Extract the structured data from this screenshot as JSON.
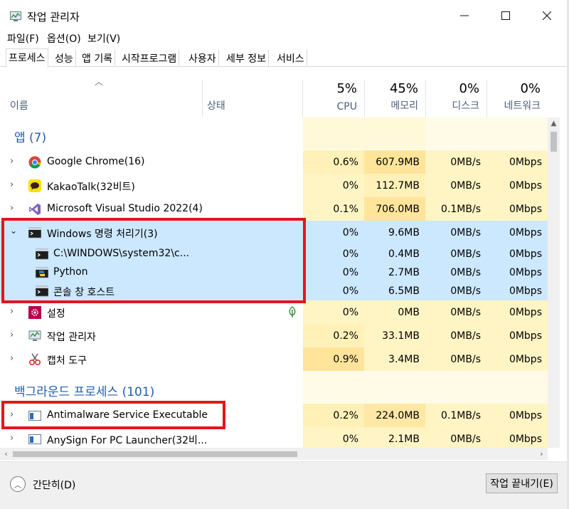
{
  "window": {
    "title": "작업 관리자",
    "buttons": {
      "minimize": "—",
      "maximize": "☐",
      "close": "✕"
    }
  },
  "menu": [
    "파일(F)",
    "옵션(O)",
    "보기(V)"
  ],
  "tabs": [
    "프로세스",
    "성능",
    "앱 기록",
    "시작프로그램",
    "사용자",
    "세부 정보",
    "서비스"
  ],
  "columns": {
    "name": "이름",
    "status": "상태",
    "cpu": {
      "percent": "5%",
      "label": "CPU"
    },
    "memory": {
      "percent": "45%",
      "label": "메모리"
    },
    "disk": {
      "percent": "0%",
      "label": "디스크"
    },
    "network": {
      "percent": "0%",
      "label": "네트워크"
    }
  },
  "groups": {
    "apps": "앱 (7)",
    "background": "백그라운드 프로세스 (101)"
  },
  "processes": [
    {
      "name": "Google Chrome(16)",
      "cpu": "0.6%",
      "mem": "607.9MB",
      "disk": "0MB/s",
      "net": "0Mbps",
      "icon": "chrome-icon"
    },
    {
      "name": "KakaoTalk(32비트)",
      "cpu": "0%",
      "mem": "112.7MB",
      "disk": "0MB/s",
      "net": "0Mbps",
      "icon": "kakaotalk-icon"
    },
    {
      "name": "Microsoft Visual Studio 2022(4)",
      "cpu": "0.1%",
      "mem": "706.0MB",
      "disk": "0.1MB/s",
      "net": "0Mbps",
      "icon": "visual-studio-icon"
    },
    {
      "name": "Windows 명령 처리기(3)",
      "cpu": "0%",
      "mem": "9.6MB",
      "disk": "0MB/s",
      "net": "0Mbps",
      "icon": "cmd-icon"
    },
    {
      "name": "C:\\WINDOWS\\system32\\c...",
      "cpu": "0%",
      "mem": "0.4MB",
      "disk": "0MB/s",
      "net": "0Mbps",
      "icon": "cmd-icon"
    },
    {
      "name": "Python",
      "cpu": "0%",
      "mem": "2.7MB",
      "disk": "0MB/s",
      "net": "0Mbps",
      "icon": "python-icon"
    },
    {
      "name": "콘솔 창 호스트",
      "cpu": "0%",
      "mem": "6.5MB",
      "disk": "0MB/s",
      "net": "0Mbps",
      "icon": "console-host-icon"
    },
    {
      "name": "설정",
      "cpu": "0%",
      "mem": "0MB",
      "disk": "0MB/s",
      "net": "0Mbps",
      "icon": "settings-icon"
    },
    {
      "name": "작업 관리자",
      "cpu": "0.2%",
      "mem": "33.1MB",
      "disk": "0MB/s",
      "net": "0Mbps",
      "icon": "task-manager-icon"
    },
    {
      "name": "캡처 도구",
      "cpu": "0.9%",
      "mem": "3.4MB",
      "disk": "0MB/s",
      "net": "0Mbps",
      "icon": "snipping-tool-icon"
    },
    {
      "name": "Antimalware Service Executable",
      "cpu": "0.2%",
      "mem": "224.0MB",
      "disk": "0.1MB/s",
      "net": "0Mbps",
      "icon": "service-icon"
    },
    {
      "name": "AnySign For PC Launcher(32비...",
      "cpu": "0%",
      "mem": "2.1MB",
      "disk": "0MB/s",
      "net": "0Mbps",
      "icon": "service-icon"
    }
  ],
  "footer": {
    "collapse_label": "간단히(D)",
    "end_task_label": "작업 끝내기(E)"
  },
  "colors": {
    "selected_row": "#cce8ff",
    "cpu_heat": "#fff4c4",
    "highlight_box": "#e3161b",
    "group_title": "#1f5fad"
  }
}
